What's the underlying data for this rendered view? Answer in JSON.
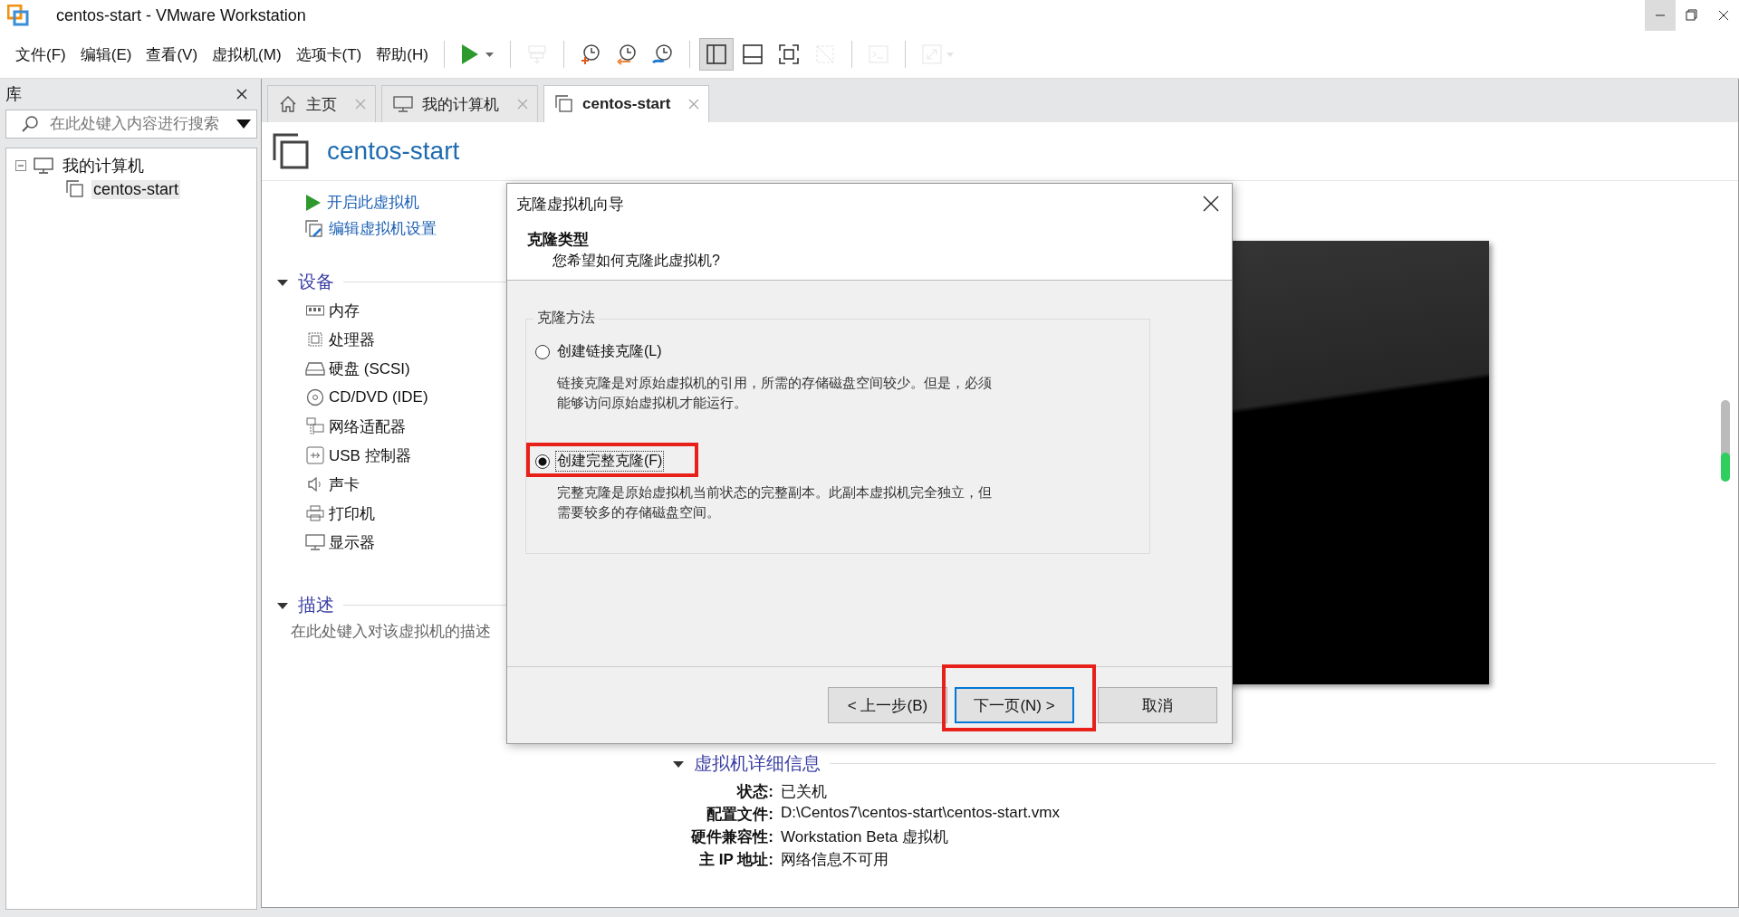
{
  "window": {
    "title": "centos-start - VMware Workstation"
  },
  "menu": [
    {
      "label": "文件(F)"
    },
    {
      "label": "编辑(E)"
    },
    {
      "label": "查看(V)"
    },
    {
      "label": "虚拟机(M)"
    },
    {
      "label": "选项卡(T)"
    },
    {
      "label": "帮助(H)"
    }
  ],
  "toolbar": [
    {
      "kind": "play",
      "disabled": false,
      "on": false
    },
    {
      "kind": "send-keys",
      "disabled": true,
      "on": false
    },
    {
      "kind": "snapshot-take",
      "disabled": false,
      "on": false
    },
    {
      "kind": "snapshot-revert",
      "disabled": false,
      "on": false
    },
    {
      "kind": "snapshot-manager",
      "disabled": false,
      "on": false
    },
    {
      "kind": "library-view",
      "disabled": false,
      "on": true
    },
    {
      "kind": "thumbnail-view",
      "disabled": false,
      "on": false
    },
    {
      "kind": "full-screen",
      "disabled": false,
      "on": false
    },
    {
      "kind": "unity",
      "disabled": true,
      "on": false
    },
    {
      "kind": "console",
      "disabled": true,
      "on": false
    },
    {
      "kind": "stretch",
      "disabled": true,
      "on": false
    }
  ],
  "library": {
    "title": "库",
    "search": {
      "placeholder": "在此处键入内容进行搜索"
    },
    "tree": [
      {
        "label": "我的计算机",
        "expanded": true,
        "selected": false,
        "children": [
          {
            "label": "centos-start",
            "selected": true
          }
        ]
      }
    ]
  },
  "tabs": [
    {
      "label": "主页",
      "kind": "home",
      "selected": false
    },
    {
      "label": "我的计算机",
      "kind": "computer",
      "selected": false
    },
    {
      "label": "centos-start",
      "kind": "vm",
      "selected": true
    }
  ],
  "vm": {
    "name": "centos-start",
    "actions": [
      {
        "label": "开启此虚拟机",
        "kind": "power-on"
      },
      {
        "label": "编辑虚拟机设置",
        "kind": "settings"
      }
    ],
    "devices": {
      "title": "设备",
      "expanded": true,
      "items": [
        {
          "name": "内存",
          "kind": "memory"
        },
        {
          "name": "处理器",
          "kind": "cpu"
        },
        {
          "name": "硬盘 (SCSI)",
          "kind": "disk"
        },
        {
          "name": "CD/DVD (IDE)",
          "kind": "cd"
        },
        {
          "name": "网络适配器",
          "kind": "network"
        },
        {
          "name": "USB 控制器",
          "kind": "usb"
        },
        {
          "name": "声卡",
          "kind": "sound"
        },
        {
          "name": "打印机",
          "kind": "printer"
        },
        {
          "name": "显示器",
          "kind": "display"
        }
      ]
    },
    "description": {
      "title": "描述",
      "expanded": true,
      "placeholder": "在此处键入对该虚拟机的描述"
    },
    "details": {
      "title": "虚拟机详细信息",
      "expanded": true,
      "rows": [
        {
          "label": "状态:",
          "value": "已关机"
        },
        {
          "label": "配置文件:",
          "value": "D:\\Centos7\\centos-start\\centos-start.vmx"
        },
        {
          "label": "硬件兼容性:",
          "value": "Workstation Beta 虚拟机"
        },
        {
          "label": "主 IP 地址:",
          "value": "网络信息不可用"
        }
      ]
    }
  },
  "dialog": {
    "title": "克隆虚拟机向导",
    "heading": "克隆类型",
    "subheading": "您希望如何克隆此虚拟机?",
    "group_title": "克隆方法",
    "options": [
      {
        "label": "创建链接克隆(L)",
        "description": "链接克隆是对原始虚拟机的引用，所需的存储磁盘空间较少。但是，必须能够访问原始虚拟机才能运行。",
        "selected": false
      },
      {
        "label": "创建完整克隆(F)",
        "description": "完整克隆是原始虚拟机当前状态的完整副本。此副本虚拟机完全独立，但需要较多的存储磁盘空间。",
        "selected": true
      }
    ],
    "buttons": [
      {
        "label": "< 上一步(B)",
        "default": false
      },
      {
        "label": "下一页(N) >",
        "default": true
      },
      {
        "label": "取消",
        "default": false
      }
    ]
  }
}
